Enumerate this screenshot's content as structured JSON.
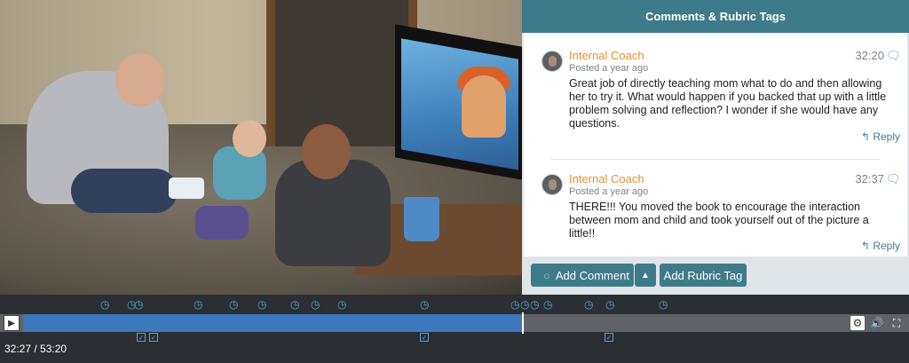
{
  "panel": {
    "title": "Comments & Rubric Tags",
    "comments": [
      {
        "author": "Internal Coach",
        "posted": "Posted a year ago",
        "time": "32:20",
        "text": "Great job of directly teaching mom what to do and then allowing her to try it. What would happen if you backed that up with a little problem solving and reflection? I wonder if she would have any questions.",
        "reply": "Reply"
      },
      {
        "author": "Internal Coach",
        "posted": "Posted a year ago",
        "time": "32:37",
        "text": "THERE!!! You moved the book to encourage the interaction between mom and child and took yourself out of the picture a little!!",
        "reply": "Reply"
      }
    ],
    "add_comment": "Add Comment",
    "add_rubric": "Add Rubric Tag"
  },
  "player": {
    "timecode": "32:27 / 53:20",
    "progress_fraction": 0.608
  },
  "icons": {
    "comment_marker": "comment-bubble-icon",
    "rubric_marker": "checkbox-icon",
    "reply": "reply-arrow-icon",
    "settings": "gear-icon",
    "volume": "volume-icon",
    "fullscreen": "fullscreen-icon"
  },
  "colors": {
    "accent": "#3e7b8a",
    "author": "#e0922f",
    "progress": "#3e78bd"
  }
}
